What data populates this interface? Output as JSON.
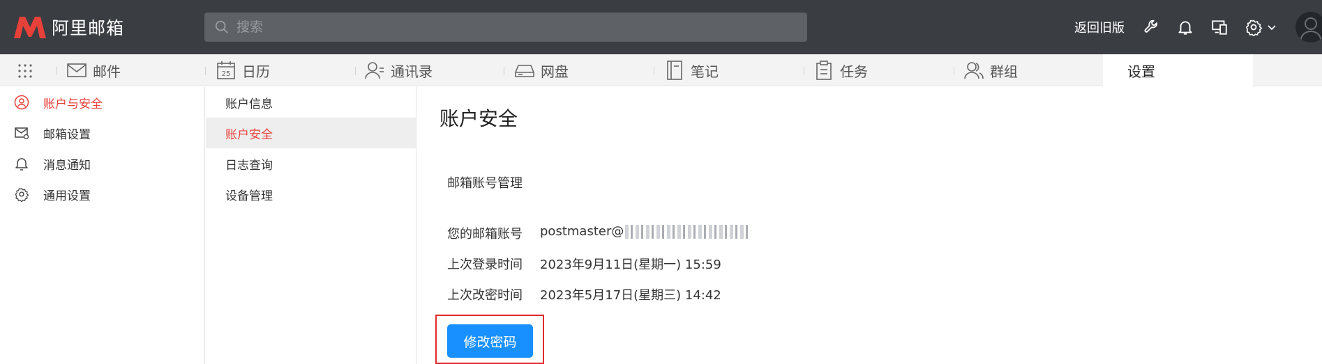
{
  "topbar": {
    "logo_text": "阿里邮箱",
    "search_placeholder": "搜索",
    "old_version": "返回旧版",
    "brand_color": "#e8413a"
  },
  "modules": [
    {
      "label": "邮件",
      "icon": "mail-icon"
    },
    {
      "label": "日历",
      "icon": "calendar-icon",
      "icon_text": "25"
    },
    {
      "label": "通讯录",
      "icon": "contacts-icon"
    },
    {
      "label": "网盘",
      "icon": "drive-icon"
    },
    {
      "label": "笔记",
      "icon": "notes-icon"
    },
    {
      "label": "任务",
      "icon": "tasks-icon"
    },
    {
      "label": "群组",
      "icon": "group-icon"
    },
    {
      "label": "设置",
      "active": true
    }
  ],
  "sidebar": {
    "items": [
      {
        "label": "账户与安全",
        "icon": "user-icon",
        "active": true
      },
      {
        "label": "邮箱设置",
        "icon": "mail-settings-icon"
      },
      {
        "label": "消息通知",
        "icon": "bell-icon"
      },
      {
        "label": "通用设置",
        "icon": "gear-icon"
      }
    ]
  },
  "submenu": {
    "items": [
      {
        "label": "账户信息"
      },
      {
        "label": "账户安全",
        "active": true
      },
      {
        "label": "日志查询"
      },
      {
        "label": "设备管理"
      }
    ]
  },
  "main": {
    "title": "账户安全",
    "section_title": "邮箱账号管理",
    "rows": [
      {
        "label": "您的邮箱账号",
        "value": "postmaster@"
      },
      {
        "label": "上次登录时间",
        "value": "2023年9月11日(星期一) 15:59"
      },
      {
        "label": "上次改密时间",
        "value": "2023年5月17日(星期三) 14:42"
      }
    ],
    "change_password_label": "修改密码",
    "button_color": "#1890ff",
    "highlight_color": "#e02c2c"
  }
}
